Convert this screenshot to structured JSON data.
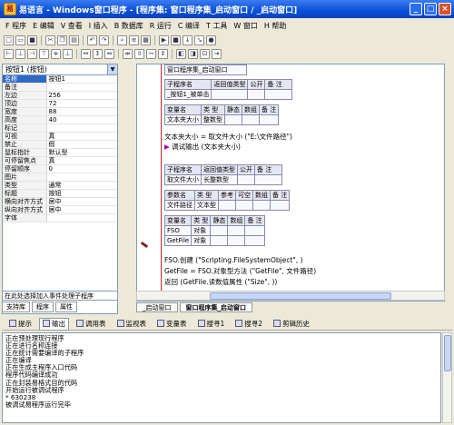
{
  "window": {
    "title": "易语言 - Windows窗口程序 - [程序集: 窗口程序集_启动窗口 / _启动窗口]"
  },
  "menu": [
    "F 程序",
    "E 编辑",
    "V 查看",
    "I 插入",
    "B 数据库",
    "R 运行",
    "C 编译",
    "T 工具",
    "W 窗口",
    "H 帮助"
  ],
  "left_panel": {
    "component": "按钮1 (按钮)",
    "properties": [
      {
        "k": "名称",
        "v": "按钮1"
      },
      {
        "k": "备注",
        "v": ""
      },
      {
        "k": "左边",
        "v": "256"
      },
      {
        "k": "顶边",
        "v": "72"
      },
      {
        "k": "宽度",
        "v": "88"
      },
      {
        "k": "高度",
        "v": "40"
      },
      {
        "k": "标记",
        "v": ""
      },
      {
        "k": "可视",
        "v": "真"
      },
      {
        "k": "禁止",
        "v": "假"
      },
      {
        "k": "鼠标指针",
        "v": "默认型"
      },
      {
        "k": "可停留焦点",
        "v": "真"
      },
      {
        "k": "停留顺序",
        "v": "0"
      },
      {
        "k": "图片",
        "v": ""
      },
      {
        "k": "类型",
        "v": "通常"
      },
      {
        "k": "标题",
        "v": "按钮"
      },
      {
        "k": "横向对齐方式",
        "v": "居中"
      },
      {
        "k": "纵向对齐方式",
        "v": "居中"
      },
      {
        "k": "字体",
        "v": ""
      }
    ],
    "event_hint": "在此处选择加入事件处理子程序",
    "tabs": [
      "支持库",
      "程序",
      "属性"
    ]
  },
  "editor": {
    "header_cell": "窗口程序集_启动窗口",
    "sub1": {
      "head": [
        "子程序名",
        "返回值类型",
        "公开",
        "备 注"
      ],
      "row": [
        "_按钮1_被单击",
        "",
        "",
        ""
      ],
      "var_head": [
        "变量名",
        "类 型",
        "静态",
        "数组",
        "备 注"
      ],
      "var_row": [
        "文本夹大小",
        "整数型",
        "",
        "",
        ""
      ],
      "code1": "文本夹大小 = 取文件大小 (\"E:\\文件路径\")",
      "code2": "调试输出 (文本夹大小)"
    },
    "sub2": {
      "head": [
        "子程序名",
        "返回值类型",
        "公开",
        "备 注"
      ],
      "row": [
        "取文件大小",
        "长整数型",
        "",
        ""
      ],
      "param_head": [
        "参数名",
        "类 型",
        "参考",
        "可空",
        "数组",
        "备 注"
      ],
      "param_row": [
        "文件路径",
        "文本型",
        "",
        "",
        "",
        ""
      ],
      "var_head": [
        "变量名",
        "类 型",
        "静态",
        "数组",
        "备 注"
      ],
      "var_rows": [
        [
          "FSO",
          "对象",
          "",
          "",
          ""
        ],
        [
          "GetFile",
          "对象",
          "",
          "",
          ""
        ]
      ],
      "code1": "FSO.创建 (\"Scripting.FileSystemObject\", )",
      "code2": "GetFile = FSO.对象型方法 (\"GetFile\", 文件路径)",
      "code3": "返回 (GetFile.读数值属性 (\"Size\", ))"
    },
    "tabs": [
      "_启动窗口",
      "窗口程序集_启动窗口"
    ]
  },
  "bottom_tabs": [
    "提示",
    "输出",
    "调用表",
    "监视表",
    "变量表",
    "搜寻1",
    "搜寻2",
    "剪辑历史"
  ],
  "output_lines": [
    "正在预处理现行程序",
    "正在进行名称连接",
    "正在统计需要编译的子程序",
    "正在编译",
    "正在生成主程序入口代码",
    "程序代码编译成功",
    "正在封装易格式目的代码",
    "开始运行被调试程序",
    "* 630238",
    "被调试易程序运行完毕"
  ]
}
